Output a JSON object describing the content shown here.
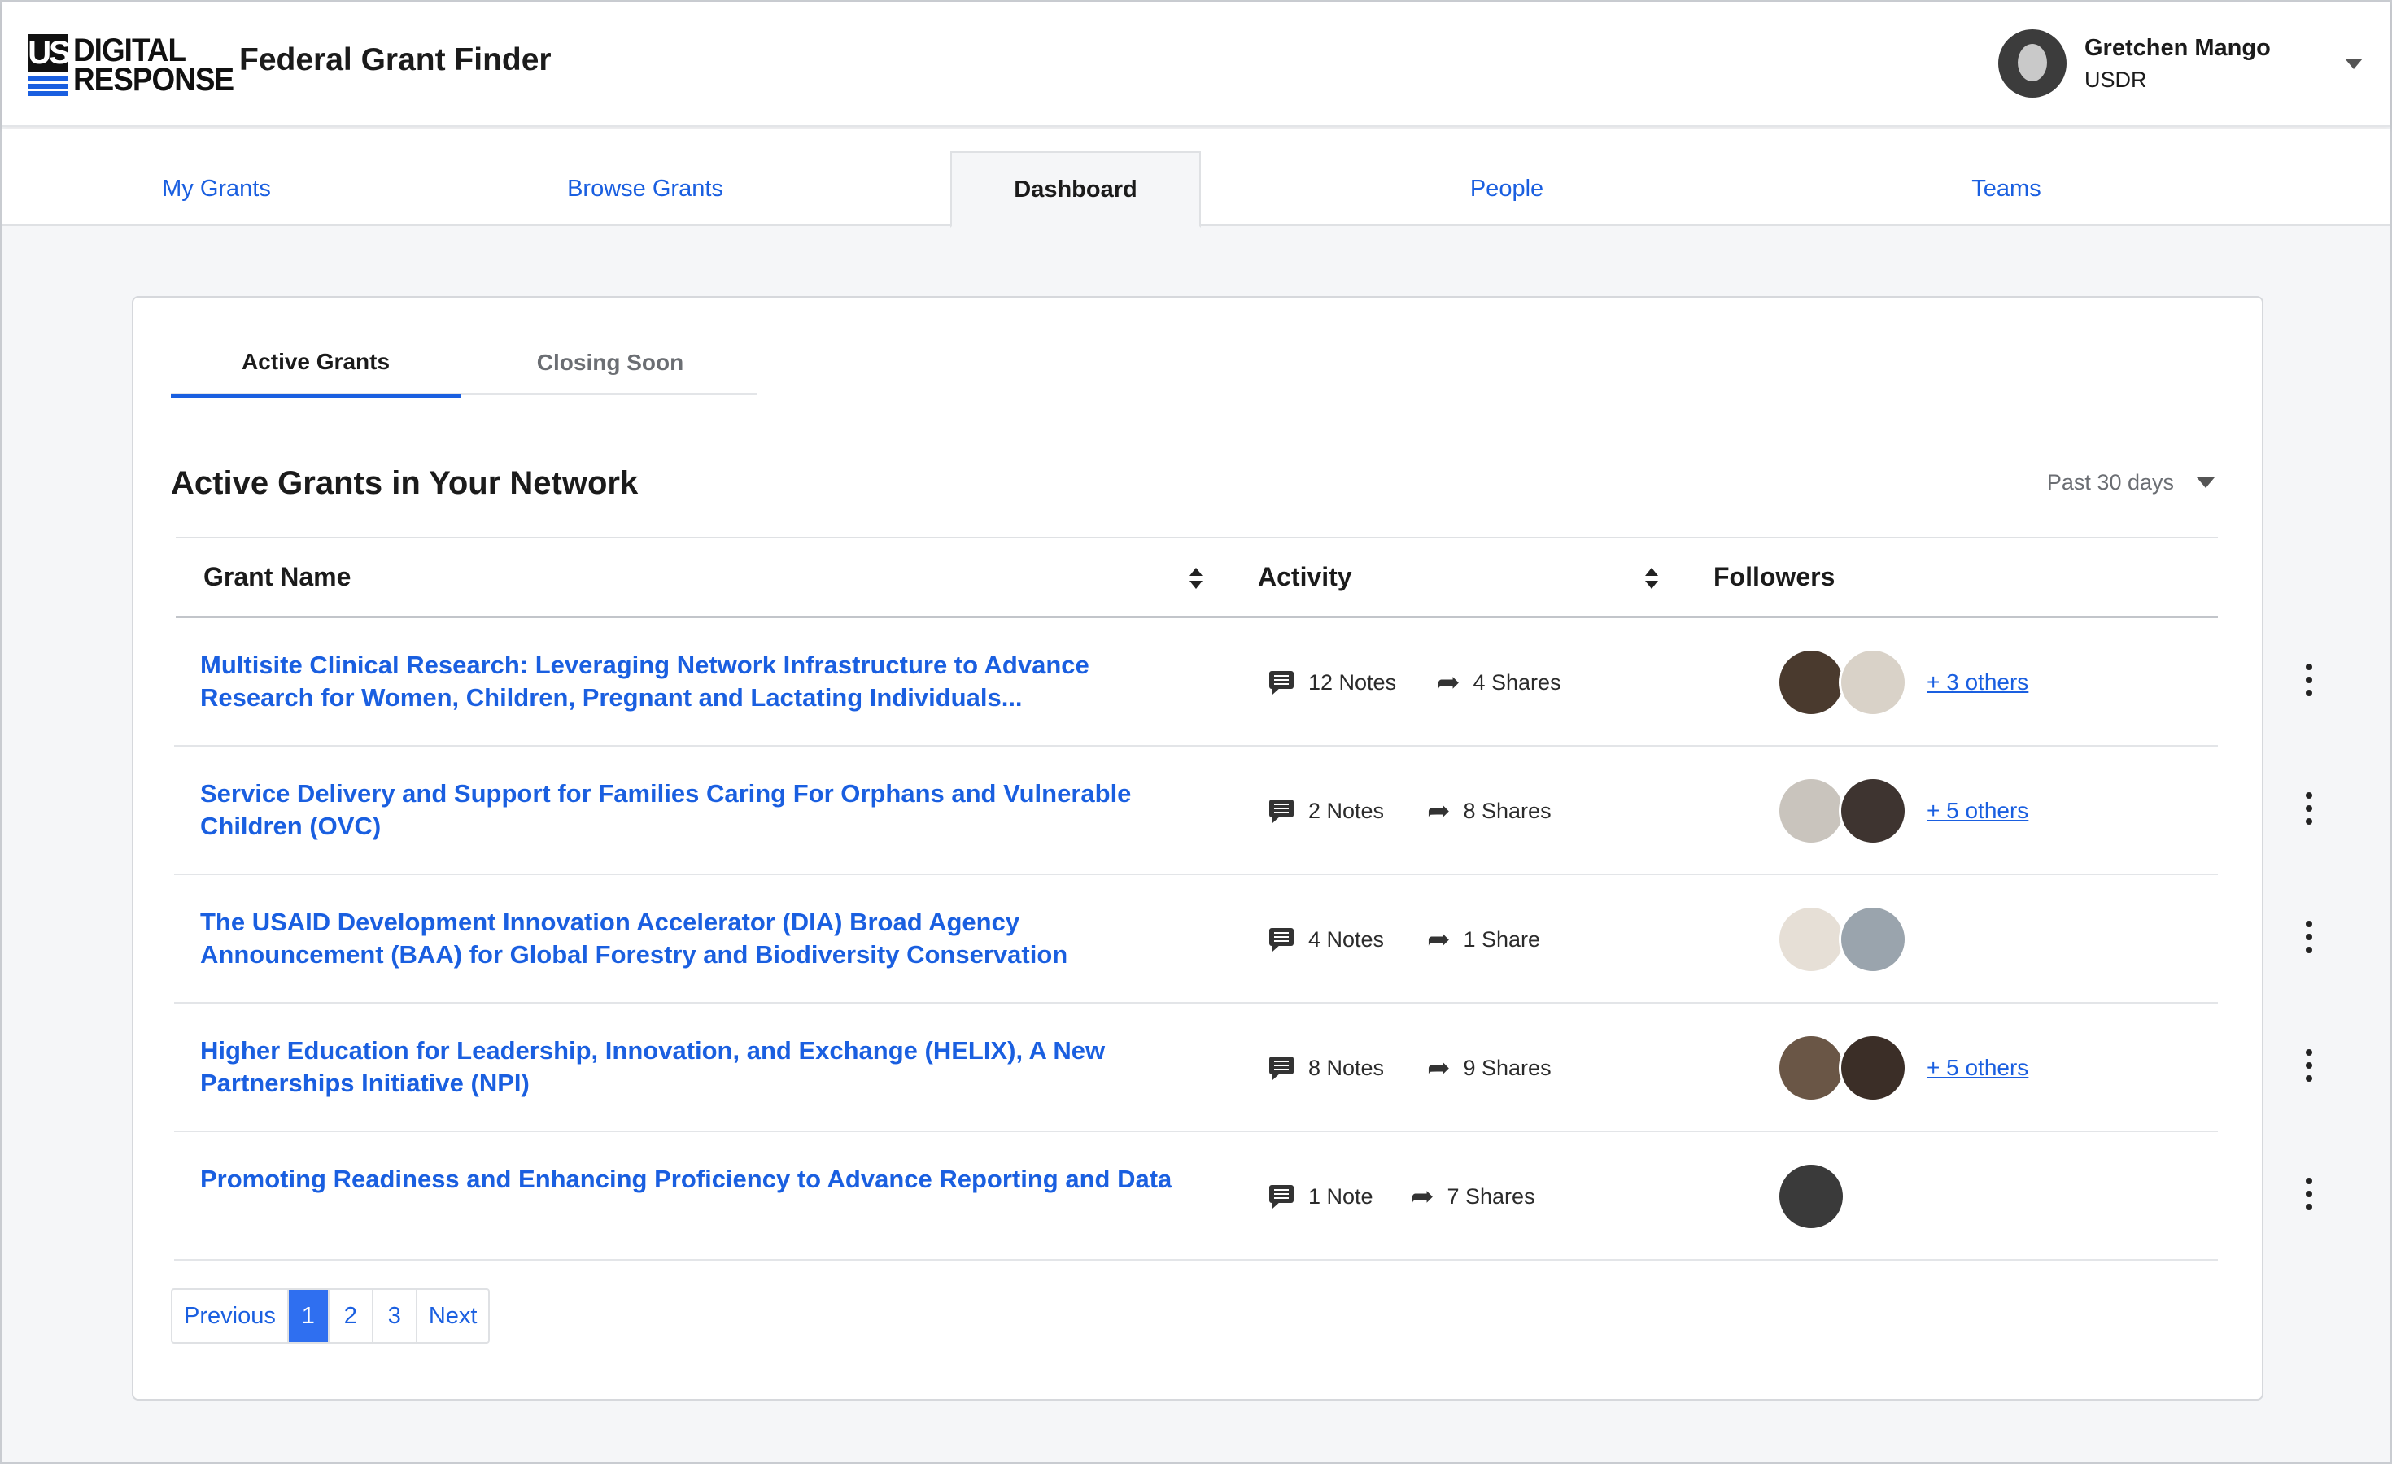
{
  "header": {
    "logo_us": "US",
    "logo_line1": "DIGITAL",
    "logo_line2": "RESPONSE",
    "app_title": "Federal Grant Finder",
    "user_name": "Gretchen Mango",
    "user_org": "USDR"
  },
  "nav": {
    "tabs": [
      {
        "label": "My Grants",
        "active": false
      },
      {
        "label": "Browse Grants",
        "active": false
      },
      {
        "label": "Dashboard",
        "active": true
      },
      {
        "label": "People",
        "active": false
      },
      {
        "label": "Teams",
        "active": false
      }
    ]
  },
  "subtabs": [
    {
      "label": "Active Grants",
      "active": true
    },
    {
      "label": "Closing Soon",
      "active": false
    }
  ],
  "section": {
    "title": "Active Grants in Your Network",
    "period": "Past 30 days"
  },
  "table": {
    "columns": [
      "Grant Name",
      "Activity",
      "Followers"
    ],
    "rows": [
      {
        "name": "Multisite Clinical Research: Leveraging Network Infrastructure to Advance Research for Women, Children, Pregnant and Lactating Individuals...",
        "notes": "12 Notes",
        "shares": "4 Shares",
        "others": "+ 3 others"
      },
      {
        "name": "Service Delivery and Support for Families Caring For Orphans and Vulnerable Children (OVC)",
        "notes": "2 Notes",
        "shares": "8 Shares",
        "others": "+ 5 others"
      },
      {
        "name": "The USAID Development Innovation Accelerator (DIA) Broad Agency Announcement (BAA) for Global Forestry and Biodiversity Conservation",
        "notes": "4 Notes",
        "shares": "1 Share",
        "others": ""
      },
      {
        "name": "Higher Education for Leadership, Innovation, and Exchange (HELIX), A New Partnerships Initiative (NPI)",
        "notes": "8 Notes",
        "shares": "9 Shares",
        "others": "+ 5 others"
      },
      {
        "name": "Promoting Readiness and Enhancing Proficiency to Advance Reporting and Data",
        "notes": "1 Note",
        "shares": "7 Shares",
        "others": ""
      }
    ]
  },
  "pagination": {
    "previous": "Previous",
    "pages": [
      "1",
      "2",
      "3"
    ],
    "current": "1",
    "next": "Next"
  },
  "colors": {
    "accent": "#1a5fe0",
    "page_background": "#f5f6f8"
  }
}
